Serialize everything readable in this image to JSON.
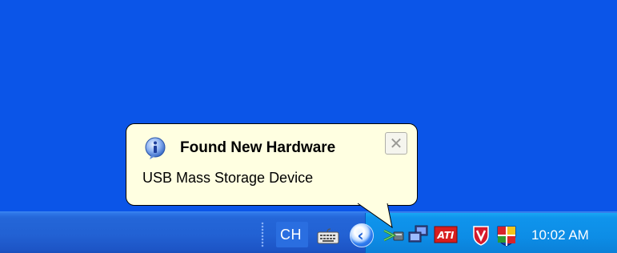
{
  "balloon": {
    "title": "Found New Hardware",
    "message": "USB Mass Storage Device",
    "close_glyph": "✕",
    "icon": "info-icon"
  },
  "taskbar": {
    "language": "CH",
    "keyboard_icon": "keyboard-icon",
    "show_hidden_glyph": "‹"
  },
  "tray": {
    "icons": [
      "safely-remove-hardware-icon",
      "network-connection-icon",
      "ati-catalyst-icon",
      "mcafee-shield-icon",
      "security-center-icon"
    ],
    "clock": "10:02 AM"
  },
  "colors": {
    "desktop": "#0b55e8",
    "taskbar": "#2261d3",
    "tray": "#0d8de6",
    "balloon_bg": "#ffffe1"
  }
}
